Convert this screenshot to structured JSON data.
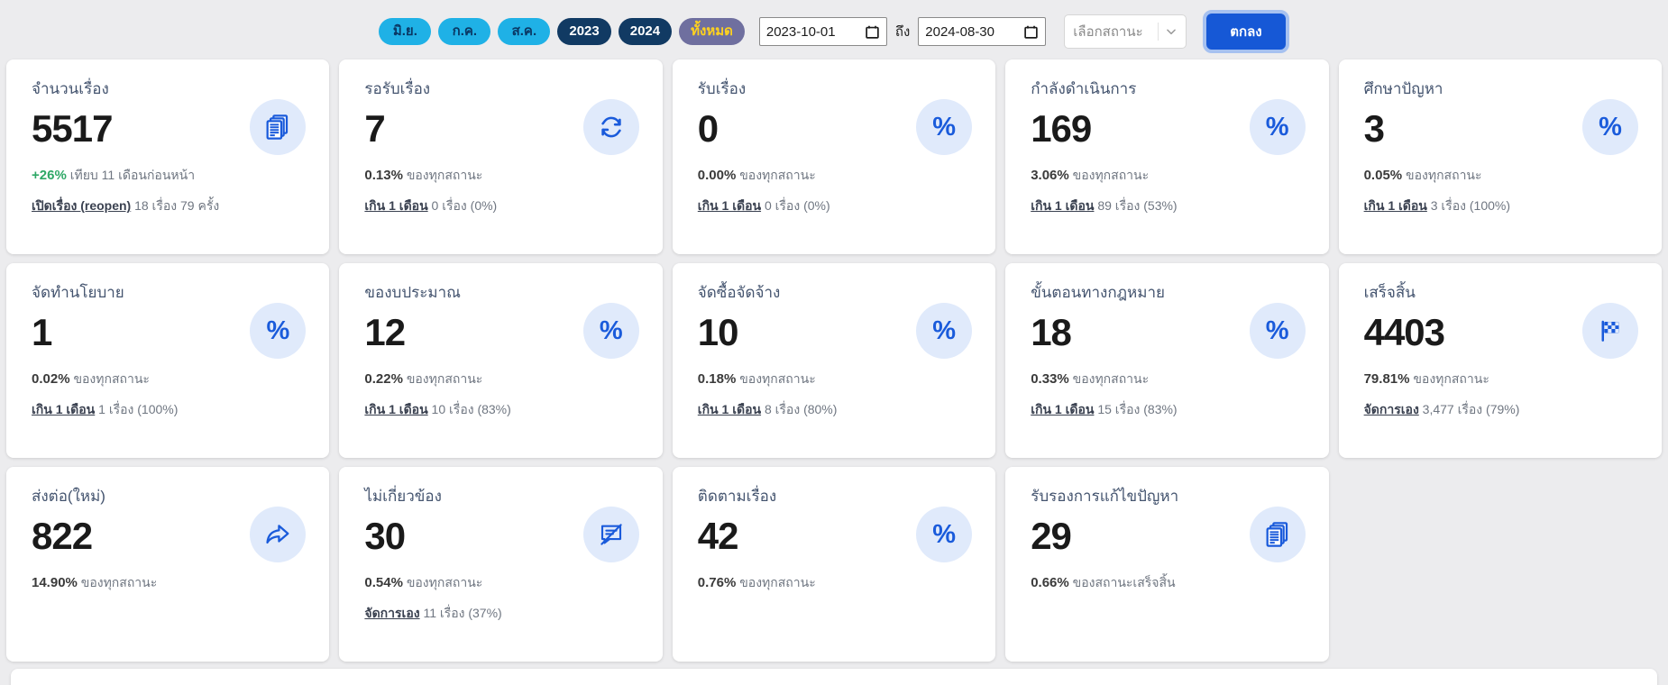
{
  "colors": {
    "accent_blue": "#1658D6",
    "button_ring": "#A6C1F0",
    "icon_blue": "#1A5BDB",
    "icon_circle_bg": "#E0EAFB",
    "green": "#2EA866",
    "pill_month_bg": "#1FB1E6",
    "pill_year_bg": "#113A63",
    "pill_all_bg": "#6F6F9F",
    "pill_all_text": "#FFD21E",
    "page_bg": "#ECECEE"
  },
  "filter_bar": {
    "pills": [
      {
        "label": "มิ.ย.",
        "style": "month"
      },
      {
        "label": "ก.ค.",
        "style": "month"
      },
      {
        "label": "ส.ค.",
        "style": "month"
      },
      {
        "label": "2023",
        "style": "year"
      },
      {
        "label": "2024",
        "style": "year"
      },
      {
        "label": "ทั้งหมด",
        "style": "all"
      }
    ],
    "date_from": "2023-10-01",
    "to_label": "ถึง",
    "date_to": "2024-08-30",
    "status_placeholder": "เลือกสถานะ",
    "submit_label": "ตกลง"
  },
  "cards": [
    {
      "title": "จำนวนเรื่อง",
      "value": "5517",
      "icon": "documents-icon",
      "line1": {
        "value": "+26%",
        "value_color": "green",
        "text": "เทียบ 11 เดือนก่อนหน้า"
      },
      "line2": {
        "link": "เปิดเรื่อง (reopen)",
        "text": "18 เรื่อง 79 ครั้ง"
      }
    },
    {
      "title": "รอรับเรื่อง",
      "value": "7",
      "icon": "refresh-icon",
      "line1": {
        "value": "0.13%",
        "text": "ของทุกสถานะ"
      },
      "line2": {
        "link": "เกิน 1 เดือน",
        "text": "0 เรื่อง (0%)"
      }
    },
    {
      "title": "รับเรื่อง",
      "value": "0",
      "icon": "percent-icon",
      "line1": {
        "value": "0.00%",
        "text": "ของทุกสถานะ"
      },
      "line2": {
        "link": "เกิน 1 เดือน",
        "text": "0 เรื่อง (0%)"
      }
    },
    {
      "title": "กำลังดำเนินการ",
      "value": "169",
      "icon": "percent-icon",
      "line1": {
        "value": "3.06%",
        "text": "ของทุกสถานะ"
      },
      "line2": {
        "link": "เกิน 1 เดือน",
        "text": "89 เรื่อง (53%)"
      }
    },
    {
      "title": "ศึกษาปัญหา",
      "value": "3",
      "icon": "percent-icon",
      "line1": {
        "value": "0.05%",
        "text": "ของทุกสถานะ"
      },
      "line2": {
        "link": "เกิน 1 เดือน",
        "text": "3 เรื่อง (100%)"
      }
    },
    {
      "title": "จัดทำนโยบาย",
      "value": "1",
      "icon": "percent-icon",
      "line1": {
        "value": "0.02%",
        "text": "ของทุกสถานะ"
      },
      "line2": {
        "link": "เกิน 1 เดือน",
        "text": "1 เรื่อง (100%)"
      }
    },
    {
      "title": "ของบประมาณ",
      "value": "12",
      "icon": "percent-icon",
      "line1": {
        "value": "0.22%",
        "text": "ของทุกสถานะ"
      },
      "line2": {
        "link": "เกิน 1 เดือน",
        "text": "10 เรื่อง (83%)"
      }
    },
    {
      "title": "จัดซื้อจัดจ้าง",
      "value": "10",
      "icon": "percent-icon",
      "line1": {
        "value": "0.18%",
        "text": "ของทุกสถานะ"
      },
      "line2": {
        "link": "เกิน 1 เดือน",
        "text": "8 เรื่อง (80%)"
      }
    },
    {
      "title": "ขั้นตอนทางกฎหมาย",
      "value": "18",
      "icon": "percent-icon",
      "line1": {
        "value": "0.33%",
        "text": "ของทุกสถานะ"
      },
      "line2": {
        "link": "เกิน 1 เดือน",
        "text": "15 เรื่อง (83%)"
      }
    },
    {
      "title": "เสร็จสิ้น",
      "value": "4403",
      "icon": "flag-icon",
      "line1": {
        "value": "79.81%",
        "text": "ของทุกสถานะ"
      },
      "line2": {
        "link": "จัดการเอง",
        "text": "3,477 เรื่อง (79%)"
      }
    },
    {
      "title": "ส่งต่อ(ใหม่)",
      "value": "822",
      "icon": "share-icon",
      "line1": {
        "value": "14.90%",
        "text": "ของทุกสถานะ"
      },
      "line2": null
    },
    {
      "title": "ไม่เกี่ยวข้อง",
      "value": "30",
      "icon": "message-slash-icon",
      "line1": {
        "value": "0.54%",
        "text": "ของทุกสถานะ"
      },
      "line2": {
        "link": "จัดการเอง",
        "text": "11 เรื่อง (37%)"
      }
    },
    {
      "title": "ติดตามเรื่อง",
      "value": "42",
      "icon": "percent-icon",
      "line1": {
        "value": "0.76%",
        "text": "ของทุกสถานะ"
      },
      "line2": null
    },
    {
      "title": "รับรองการแก้ไขปัญหา",
      "value": "29",
      "icon": "documents-icon",
      "line1": {
        "value": "0.66%",
        "text": "ของสถานะเสร็จสิ้น"
      },
      "line2": null
    }
  ]
}
